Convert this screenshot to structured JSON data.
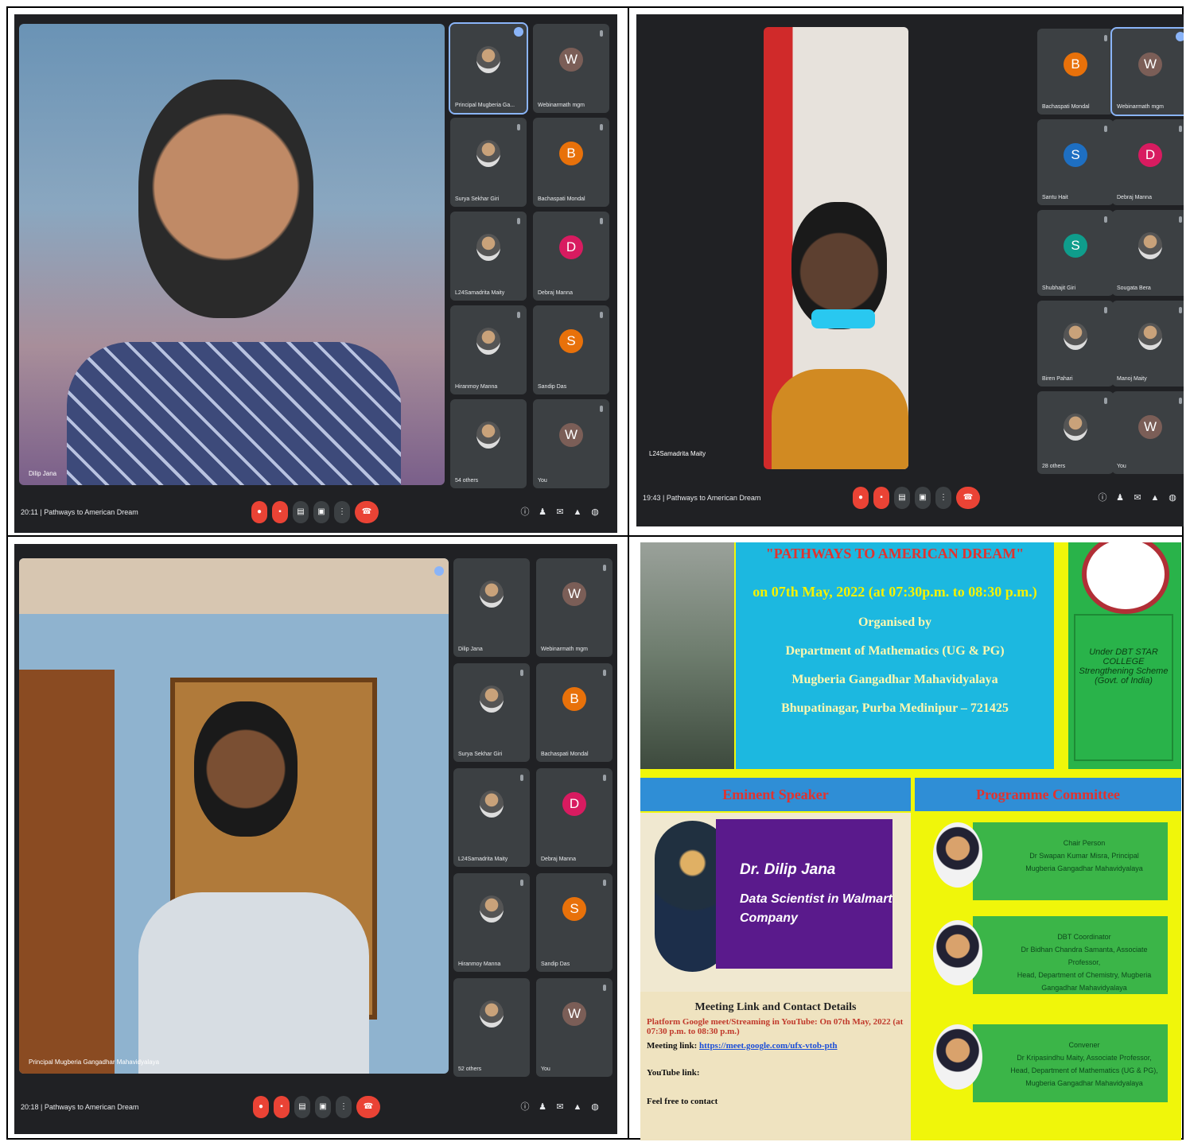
{
  "panels": {
    "tl": {
      "time": "20:11",
      "meeting": "Pathways to American Dream",
      "speaker": "Dilip Jana",
      "tiles": [
        {
          "name": "Principal Mugberia Ga...",
          "initial": "",
          "color": ""
        },
        {
          "name": "Webinarmath mgm",
          "initial": "W",
          "color": "#7b5e57"
        },
        {
          "name": "Surya Sekhar Giri",
          "initial": "",
          "color": ""
        },
        {
          "name": "Bachaspati Mondal",
          "initial": "B",
          "color": "#e8710a"
        },
        {
          "name": "L24Samadrita Maity",
          "initial": "",
          "color": ""
        },
        {
          "name": "Debraj Manna",
          "initial": "D",
          "color": "#d81b60"
        },
        {
          "name": "Hiranmoy Manna",
          "initial": "",
          "color": ""
        },
        {
          "name": "Sandip Das",
          "initial": "S",
          "color": "#e8710a"
        },
        {
          "name": "54 others",
          "initial": "",
          "color": ""
        },
        {
          "name": "You",
          "initial": "W",
          "color": "#7b5e57"
        }
      ]
    },
    "tr": {
      "time": "19:43",
      "meeting": "Pathways to American Dream",
      "speaker": "L24Samadrita Maity",
      "tiles": [
        {
          "name": "Bachaspati Mondal",
          "initial": "B",
          "color": "#e8710a"
        },
        {
          "name": "Webinarmath mgm",
          "initial": "W",
          "color": "#7b5e57"
        },
        {
          "name": "Santu Hait",
          "initial": "S",
          "color": "#1e6fc2"
        },
        {
          "name": "Debraj Manna",
          "initial": "D",
          "color": "#d81b60"
        },
        {
          "name": "Shubhajit Giri",
          "initial": "S",
          "color": "#0f9d8c"
        },
        {
          "name": "Sougata Bera",
          "initial": "",
          "color": ""
        },
        {
          "name": "Biren Pahari",
          "initial": "",
          "color": ""
        },
        {
          "name": "Manoj Maity",
          "initial": "",
          "color": ""
        },
        {
          "name": "28 others",
          "initial": "",
          "color": ""
        },
        {
          "name": "You",
          "initial": "W",
          "color": "#7b5e57"
        }
      ]
    },
    "bl": {
      "time": "20:18",
      "meeting": "Pathways to American Dream",
      "speaker": "Principal Mugberia Gangadhar Mahavidyalaya",
      "tiles": [
        {
          "name": "Dilip Jana",
          "initial": "",
          "color": ""
        },
        {
          "name": "Webinarmath mgm",
          "initial": "W",
          "color": "#7b5e57"
        },
        {
          "name": "Surya Sekhar Giri",
          "initial": "",
          "color": ""
        },
        {
          "name": "Bachaspati Mondal",
          "initial": "B",
          "color": "#e8710a"
        },
        {
          "name": "L24Samadrita Maity",
          "initial": "",
          "color": ""
        },
        {
          "name": "Debraj Manna",
          "initial": "D",
          "color": "#d81b60"
        },
        {
          "name": "Hiranmoy Manna",
          "initial": "",
          "color": ""
        },
        {
          "name": "Sandip Das",
          "initial": "S",
          "color": "#e8710a"
        },
        {
          "name": "52 others",
          "initial": "",
          "color": ""
        },
        {
          "name": "You",
          "initial": "W",
          "color": "#7b5e57"
        }
      ]
    }
  },
  "poster": {
    "title": "\"PATHWAYS TO AMERICAN DREAM\"",
    "date": "on 07th May, 2022 (at 07:30p.m. to 08:30 p.m.)",
    "organised_by": "Organised by",
    "dept": "Department of Mathematics (UG & PG)",
    "college": "Mugberia Gangadhar Mahavidyalaya",
    "address": "Bhupatinagar, Purba Medinipur – 721425",
    "scheme": "Under DBT STAR COLLEGE Strengthening Scheme (Govt. of India)",
    "eminent_speaker": "Eminent Speaker",
    "programme_committee": "Programme Committee",
    "speaker_name": "Dr. Dilip Jana",
    "speaker_role": "Data Scientist in Walmart Company",
    "meeting_heading": "Meeting Link and Contact Details",
    "platform": "Platform Google meet/Streaming in YouTube: On 07th May, 2022 (at 07:30 p.m. to 08:30 p.m.)",
    "meeting_link_label": "Meeting link:",
    "meeting_link": "https://meet.google.com/ufx-vtob-pth",
    "youtube_label": "YouTube link:",
    "feel_free": "Feel free to contact",
    "committee": [
      {
        "role": "Chair Person",
        "name": "Dr Swapan Kumar Misra, Principal",
        "org": "Mugberia Gangadhar Mahavidyalaya"
      },
      {
        "role": "DBT Coordinator",
        "name": "Dr Bidhan Chandra Samanta, Associate Professor,",
        "org": "Head, Department of Chemistry, Mugberia Gangadhar Mahavidyalaya"
      },
      {
        "role": "Convener",
        "name": "Dr Kripasindhu Maity, Associate Professor,",
        "org": "Head, Department of Mathematics (UG & PG), Mugberia Gangadhar Mahavidyalaya"
      }
    ]
  }
}
